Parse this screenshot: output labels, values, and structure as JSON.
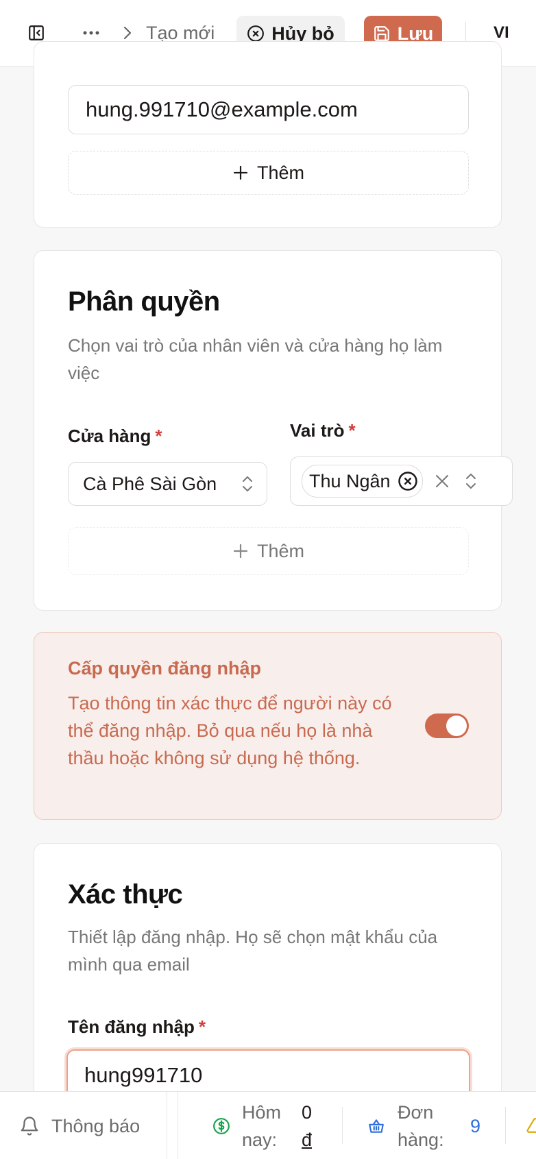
{
  "header": {
    "breadcrumb_current": "Tạo mới",
    "cancel_label": "Hủy bỏ",
    "save_label": "Lưu",
    "language": "VI"
  },
  "email_section": {
    "email_value": "hung.991710@example.com",
    "add_label": "Thêm"
  },
  "roles_section": {
    "title": "Phân quyền",
    "description": "Chọn vai trò của nhân viên và cửa hàng họ làm việc",
    "store_label": "Cửa hàng",
    "store_value": "Cà Phê Sài Gòn",
    "role_label": "Vai trò",
    "role_tag": "Thu Ngân",
    "required_mark": "*",
    "add_label": "Thêm"
  },
  "login_permission": {
    "title": "Cấp quyền đăng nhập",
    "description": "Tạo thông tin xác thực để người này có thể đăng nhập. Bỏ qua nếu họ là nhà thầu hoặc không sử dụng hệ thống.",
    "enabled": true
  },
  "auth_section": {
    "title": "Xác thực",
    "description": "Thiết lập đăng nhập. Họ sẽ chọn mật khẩu của mình qua email",
    "username_label": "Tên đăng nhập",
    "username_value": "hung991710",
    "required_mark": "*"
  },
  "status_bar": {
    "notifications_label": "Thông báo",
    "today_label_line1": "Hôm",
    "today_label_line2": "nay:",
    "today_value_line1": "0",
    "today_value_line2": "đ",
    "orders_label_line1": "Đơn",
    "orders_label_line2": "hàng:",
    "orders_value": "9"
  },
  "colors": {
    "accent": "#cf6a4f",
    "warning_bg": "#f8efec",
    "required": "#d43b3b",
    "money_icon": "#16a34a",
    "orders": "#2f6fdc"
  }
}
